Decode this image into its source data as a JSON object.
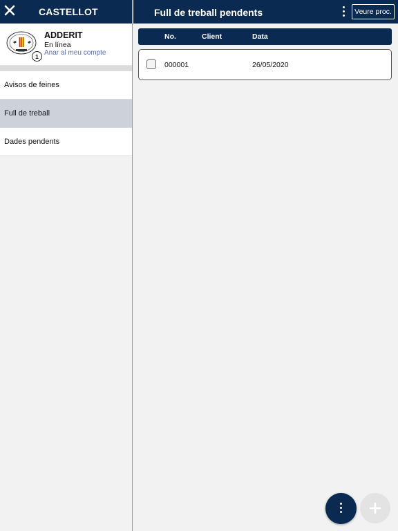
{
  "sidebar": {
    "title": "CASTELLOT",
    "account": {
      "name": "ADDERIT",
      "status": "En línea",
      "link": "Anar al meu compte",
      "badge": "1"
    },
    "items": [
      {
        "label": "Avisos de feines",
        "active": false
      },
      {
        "label": "Full de treball",
        "active": true
      },
      {
        "label": "Dades pendents",
        "active": false
      }
    ]
  },
  "header": {
    "title": "Full de treball pendents",
    "veure_button": "Veure proc."
  },
  "table": {
    "columns": [
      "No.",
      "Client",
      "Data"
    ],
    "rows": [
      {
        "no": "000001",
        "client": "",
        "data": "26/05/2020",
        "checked": false
      }
    ]
  },
  "colors": {
    "primary": "#0b2a52",
    "active_item": "#cdd2da",
    "link": "#5a6fb0"
  }
}
